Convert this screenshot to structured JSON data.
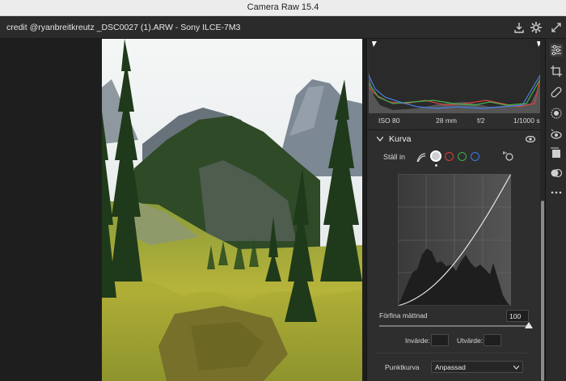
{
  "window": {
    "title": "Camera Raw 15.4"
  },
  "toolbar": {
    "file_info": "credit @ryanbreitkreutz _DSC0027 (1).ARW  -  Sony ILCE-7M3"
  },
  "histogram": {
    "iso": "ISO 80",
    "focal": "28 mm",
    "aperture": "f/2",
    "shutter": "1/1000 s"
  },
  "curve": {
    "section_title": "Kurva",
    "adjust_label": "Ställ in",
    "refine_label": "Förfina mättnad",
    "refine_value": "100",
    "refine_level": 1.0,
    "input_label": "Invärde:",
    "output_label": "Utvärde:",
    "input_value": "",
    "output_value": "",
    "point_curve_label": "Punktkurva",
    "point_curve_value": "Anpassad"
  },
  "colors": {
    "red": "#e23a3a",
    "green": "#3fae49",
    "blue": "#3b78e7",
    "panel": "#2e2e2e"
  }
}
